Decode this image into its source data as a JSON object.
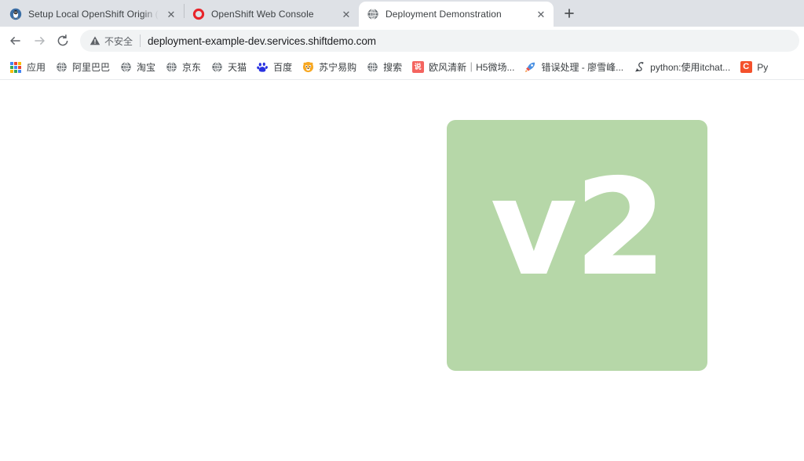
{
  "browser": {
    "tabs": [
      {
        "title": "Setup Local OpenShift Origin (",
        "favicon": "penguin-icon",
        "active": false,
        "close_label": "✕"
      },
      {
        "title": "OpenShift Web Console",
        "favicon": "openshift-ring-icon",
        "active": false,
        "close_label": "✕"
      },
      {
        "title": "Deployment Demonstration",
        "favicon": "globe-icon",
        "active": true,
        "close_label": "✕"
      }
    ],
    "new_tab_label": "+",
    "toolbar": {
      "back_label": "←",
      "forward_label": "→",
      "reload_label": "⟳",
      "security_warning_icon": "warning-triangle-icon",
      "security_text": "不安全",
      "url": "deployment-example-dev.services.shiftdemo.com"
    },
    "bookmarks": [
      {
        "label": "应用",
        "icon": "apps-grid-icon"
      },
      {
        "label": "阿里巴巴",
        "icon": "globe-icon"
      },
      {
        "label": "淘宝",
        "icon": "globe-icon"
      },
      {
        "label": "京东",
        "icon": "globe-icon"
      },
      {
        "label": "天猫",
        "icon": "globe-icon"
      },
      {
        "label": "百度",
        "icon": "baidu-paw-icon"
      },
      {
        "label": "苏宁易购",
        "icon": "suning-lion-icon"
      },
      {
        "label": "搜索",
        "icon": "globe-icon"
      },
      {
        "label": "欧风清新｜H5微场...",
        "icon": "shuo-square-icon",
        "icon_text": "说"
      },
      {
        "label": "错误处理 - 廖雪峰...",
        "icon": "rocket-icon"
      },
      {
        "label": "python:使用itchat...",
        "icon": "snake-icon"
      },
      {
        "label": "Py",
        "icon": "c-square-icon",
        "icon_text": "C"
      }
    ]
  },
  "page": {
    "version_label": "v2",
    "card_color": "#b6d7a8",
    "background_color": "#ffffff"
  }
}
